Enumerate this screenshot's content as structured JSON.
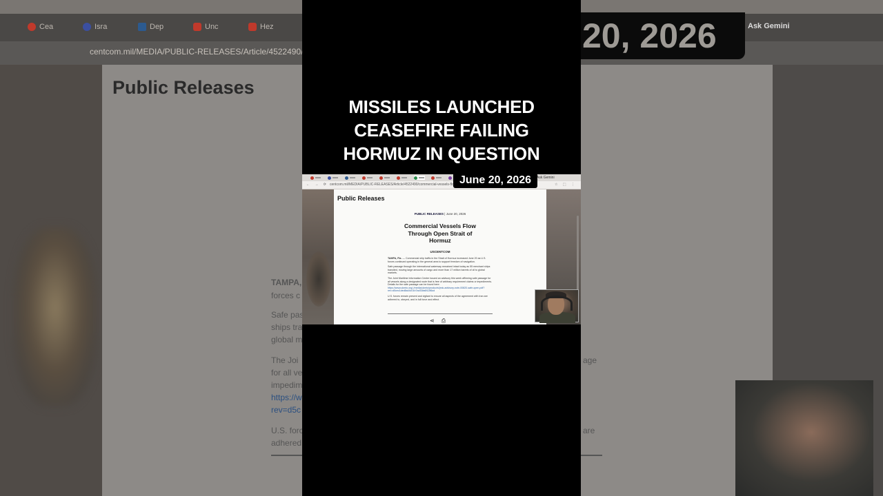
{
  "headline_lines": [
    "MISSILES LAUNCHED",
    "CEASEFIRE FAILING",
    "HORMUZ IN QUESTION"
  ],
  "date_badge": "June 20, 2026",
  "background": {
    "big_date": "20, 2026",
    "ask_gemini": "Ask Gemini",
    "url": "centcom.mil/MEDIA/PUBLIC-RELEASES/Article/4522490/cor",
    "page_heading": "Public Releases",
    "tabs": [
      {
        "label": "Cea",
        "color": "#c0392b"
      },
      {
        "label": "Isra",
        "color": "#3b4fa0"
      },
      {
        "label": "Dep",
        "color": "#2c5a8f"
      },
      {
        "label": "Unc",
        "color": "#c0392b"
      },
      {
        "label": "Hez",
        "color": "#c0392b"
      }
    ],
    "text_fragments": [
      "TAMPA,",
      "forces c",
      "Safe pas",
      "ships tra",
      "global m",
      "The Joi",
      "for all ve",
      "impedim",
      "https://w",
      "rev=d5c",
      "U.S. forc",
      "adhered",
      "age",
      "are"
    ]
  },
  "browser": {
    "url": "centcom.mil/MEDIA/PUBLIC-RELEASES/Article/4522490/commercial-vessels-flow-through-open-strait-of-hormuz/",
    "ask_gemini": "Ask Gemini"
  },
  "article": {
    "section_heading": "Public Releases",
    "meta_label": "PUBLIC RELEASES",
    "meta_date": "June 20, 2026",
    "title_lines": [
      "Commercial Vessels Flow",
      "Through Open Strait of",
      "Hormuz"
    ],
    "organization": "USCENTCOM",
    "paragraph_1_lead": "TAMPA, Fla.",
    "paragraph_1": " — Commercial ship traffic in the Strait of Hormuz increased June 20 as U.S. forces continued operating in the general area to support freedom of navigation.",
    "paragraph_2": "Safe passage through the international waterway remained intact today as 55 merchant ships transited, moving large amounts of cargo and more than 17 million barrels of oil to global markets.",
    "paragraph_3": "The Joint Maritime Information Center issued an advisory this week affirming safe passage for all vessels along a designated route that is free of arbitrary requirement claims or impediments. Details for the safe passage can be found here:",
    "link": "https://www.ukmto.org/-/media/ukmto/products/jmic-advisory-note-00820-safe-open.pdf?rev=d5cec1ded8a44c01b7ad33fa6f1286cd",
    "paragraph_4": "U.S. forces remain present and vigilant to ensure all aspects of the agreement with Iran are adhered to, obeyed, and in full force and effect."
  }
}
